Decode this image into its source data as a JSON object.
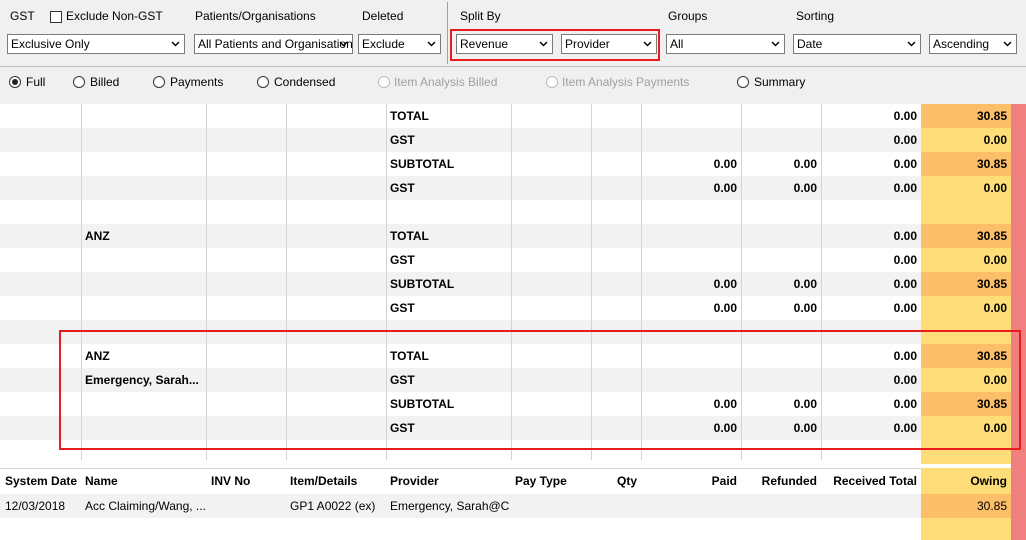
{
  "toolbar": {
    "gst": {
      "label": "GST",
      "exclude_non_gst_label": "Exclude Non-GST",
      "value": "Exclusive Only"
    },
    "patients": {
      "label": "Patients/Organisations",
      "value": "All Patients and Organisations"
    },
    "deleted": {
      "label": "Deleted",
      "value": "Exclude"
    },
    "split_by": {
      "label": "Split By",
      "first": "Revenue",
      "second": "Provider"
    },
    "groups": {
      "label": "Groups",
      "value": "All"
    },
    "sorting": {
      "label": "Sorting",
      "field": "Date",
      "order": "Ascending"
    }
  },
  "report_types": [
    {
      "label": "Full",
      "checked": true,
      "disabled": false
    },
    {
      "label": "Billed",
      "checked": false,
      "disabled": false
    },
    {
      "label": "Payments",
      "checked": false,
      "disabled": false
    },
    {
      "label": "Condensed",
      "checked": false,
      "disabled": false
    },
    {
      "label": "Item Analysis Billed",
      "checked": false,
      "disabled": true
    },
    {
      "label": "Item Analysis Payments",
      "checked": false,
      "disabled": true
    },
    {
      "label": "Summary",
      "checked": false,
      "disabled": false
    }
  ],
  "summary_rows": [
    {
      "name": "",
      "label": "TOTAL",
      "paid": "",
      "refunded": "",
      "received": "0.00",
      "owing": "30.85",
      "alt": false
    },
    {
      "name": "",
      "label": "GST",
      "paid": "",
      "refunded": "",
      "received": "0.00",
      "owing": "0.00",
      "alt": true
    },
    {
      "name": "",
      "label": "SUBTOTAL",
      "paid": "0.00",
      "refunded": "0.00",
      "received": "0.00",
      "owing": "30.85",
      "alt": false
    },
    {
      "name": "",
      "label": "GST",
      "paid": "0.00",
      "refunded": "0.00",
      "received": "0.00",
      "owing": "0.00",
      "alt": true
    },
    {
      "name": "",
      "label": "",
      "paid": "",
      "refunded": "",
      "received": "",
      "owing": "",
      "alt": false
    },
    {
      "name": "ANZ",
      "label": "TOTAL",
      "paid": "",
      "refunded": "",
      "received": "0.00",
      "owing": "30.85",
      "alt": true
    },
    {
      "name": "",
      "label": "GST",
      "paid": "",
      "refunded": "",
      "received": "0.00",
      "owing": "0.00",
      "alt": false
    },
    {
      "name": "",
      "label": "SUBTOTAL",
      "paid": "0.00",
      "refunded": "0.00",
      "received": "0.00",
      "owing": "30.85",
      "alt": true
    },
    {
      "name": "",
      "label": "GST",
      "paid": "0.00",
      "refunded": "0.00",
      "received": "0.00",
      "owing": "0.00",
      "alt": false
    },
    {
      "name": "",
      "label": "",
      "paid": "",
      "refunded": "",
      "received": "",
      "owing": "",
      "alt": true
    },
    {
      "name": "ANZ",
      "label": "TOTAL",
      "paid": "",
      "refunded": "",
      "received": "0.00",
      "owing": "30.85",
      "alt": false
    },
    {
      "name": "Emergency, Sarah...",
      "label": "GST",
      "paid": "",
      "refunded": "",
      "received": "0.00",
      "owing": "0.00",
      "alt": true
    },
    {
      "name": "",
      "label": "SUBTOTAL",
      "paid": "0.00",
      "refunded": "0.00",
      "received": "0.00",
      "owing": "30.85",
      "alt": false
    },
    {
      "name": "",
      "label": "GST",
      "paid": "0.00",
      "refunded": "0.00",
      "received": "0.00",
      "owing": "0.00",
      "alt": true
    },
    {
      "name": "",
      "label": "",
      "paid": "",
      "refunded": "",
      "received": "",
      "owing": "",
      "alt": false
    }
  ],
  "columns": [
    "System Date",
    "Name",
    "INV No",
    "Item/Details",
    "Provider",
    "Pay Type",
    "Qty",
    "Paid",
    "Refunded",
    "Received Total",
    "Owing"
  ],
  "detail_rows": [
    {
      "system_date": "12/03/2018",
      "name": "Acc Claiming/Wang, ...",
      "inv_no": "",
      "item_details": "GP1 A0022 (ex)",
      "provider": "Emergency, Sarah@C...",
      "pay_type": "",
      "qty": "",
      "paid": "",
      "refunded": "",
      "received_total": "",
      "owing": "30.85"
    }
  ],
  "colors": {
    "owing_dark": "#fdbe6a",
    "owing_light": "#fedd78",
    "highlight_red": "#e81c1c",
    "right_strip": "#f08080"
  },
  "icons": {
    "dropdown": "chevron-down-icon"
  }
}
